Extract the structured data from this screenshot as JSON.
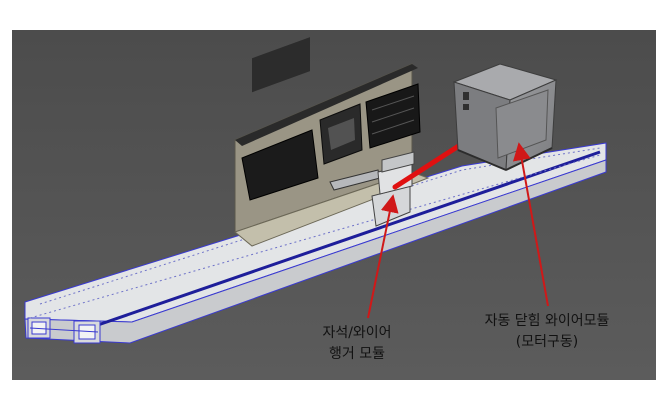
{
  "labels": {
    "magnet_wire_hanger": [
      "자석/와이어",
      "행거 모듈"
    ],
    "auto_close_wire": [
      "자동 닫힘 와이어모듈",
      "(모터구동)"
    ]
  },
  "colors": {
    "viewport_background": "#555555",
    "rail_body": "#e6e8ea",
    "rail_edge": "#3a3ad0",
    "rail_groove": "#1e1e9a",
    "callout": "#d01818",
    "motor_box": "#8f9093",
    "board": "#b7b29f"
  },
  "icons": [
    "callout-arrow",
    "laser-beam"
  ]
}
